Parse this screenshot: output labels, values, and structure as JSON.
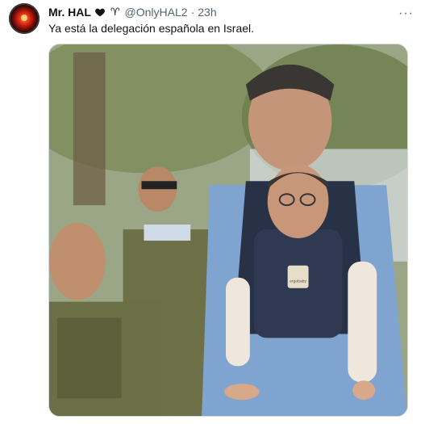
{
  "tweet": {
    "author_name": "Mr. HAL",
    "handle": "@OnlyHAL2",
    "separator": "·",
    "time": "23h",
    "text": "Ya está la delegación española en Israel.",
    "icons": {
      "verified": "heart-icon",
      "handle_symbol": "aries-icon",
      "more": "more-icon"
    }
  },
  "media": {
    "carrier_label": "ergobaby"
  },
  "colors": {
    "text_primary": "#0f1419",
    "text_secondary": "#536471",
    "border": "#cfd9de"
  }
}
